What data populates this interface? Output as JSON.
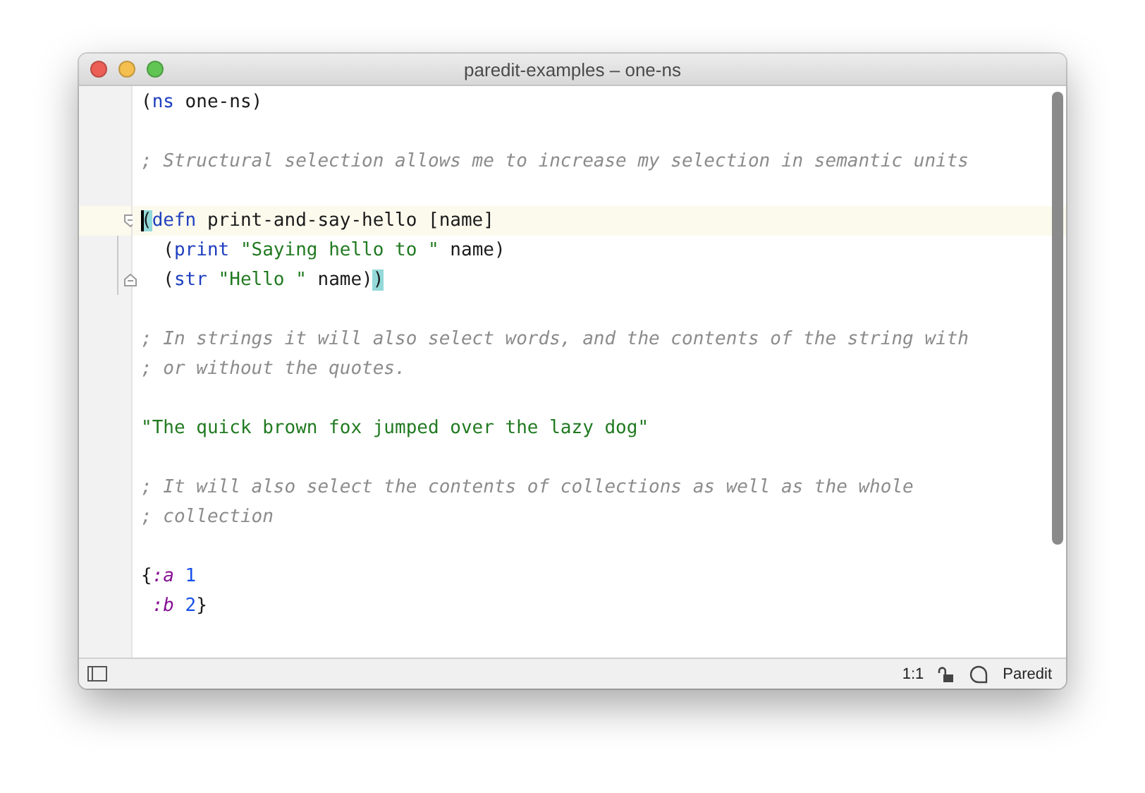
{
  "window": {
    "title": "paredit-examples – one-ns"
  },
  "editor": {
    "blocks": [
      {
        "lines": [
          {
            "tokens": [
              {
                "kind": "plain",
                "text": "("
              },
              {
                "kind": "keyword",
                "text": "ns"
              },
              {
                "kind": "plain",
                "text": " one-ns)"
              }
            ]
          }
        ]
      },
      {
        "lines": [
          {
            "tokens": [
              {
                "kind": "comment",
                "text": "; Structural selection allows me to increase my selection in semantic units"
              }
            ]
          }
        ]
      },
      {
        "lines": [
          {
            "current": true,
            "caret": true,
            "fold_start": true,
            "tokens": [
              {
                "kind": "match",
                "text": "("
              },
              {
                "kind": "keyword",
                "text": "defn"
              },
              {
                "kind": "plain",
                "text": " print-and-say-hello [name]"
              }
            ]
          },
          {
            "guide": true,
            "tokens": [
              {
                "kind": "plain",
                "text": "  ("
              },
              {
                "kind": "keyword",
                "text": "print"
              },
              {
                "kind": "string",
                "text": " \"Saying hello to \""
              },
              {
                "kind": "plain",
                "text": " name)"
              }
            ]
          },
          {
            "guide": true,
            "fold_end": true,
            "tokens": [
              {
                "kind": "plain",
                "text": "  ("
              },
              {
                "kind": "keyword",
                "text": "str"
              },
              {
                "kind": "string",
                "text": " \"Hello \""
              },
              {
                "kind": "plain",
                "text": " name)"
              },
              {
                "kind": "match",
                "text": ")"
              }
            ]
          }
        ]
      },
      {
        "lines": [
          {
            "tokens": [
              {
                "kind": "comment",
                "text": "; In strings it will also select words, and the contents of the string with"
              }
            ]
          },
          {
            "tokens": [
              {
                "kind": "comment",
                "text": "; or without the quotes."
              }
            ]
          }
        ]
      },
      {
        "lines": [
          {
            "tokens": [
              {
                "kind": "string",
                "text": "\"The quick brown fox jumped over the lazy dog\""
              }
            ]
          }
        ]
      },
      {
        "lines": [
          {
            "tokens": [
              {
                "kind": "comment",
                "text": "; It will also select the contents of collections as well as the whole"
              }
            ]
          },
          {
            "tokens": [
              {
                "kind": "comment",
                "text": "; collection"
              }
            ]
          }
        ]
      },
      {
        "lines": [
          {
            "tokens": [
              {
                "kind": "plain",
                "text": "{"
              },
              {
                "kind": "keyword-arg",
                "text": ":a"
              },
              {
                "kind": "number",
                "text": " 1"
              }
            ]
          },
          {
            "tokens": [
              {
                "kind": "keyword-arg",
                "text": " :b"
              },
              {
                "kind": "number",
                "text": " 2"
              },
              {
                "kind": "plain",
                "text": "}"
              }
            ]
          }
        ]
      }
    ]
  },
  "status_bar": {
    "position": "1:1",
    "locked": false,
    "mode": "Paredit"
  }
}
